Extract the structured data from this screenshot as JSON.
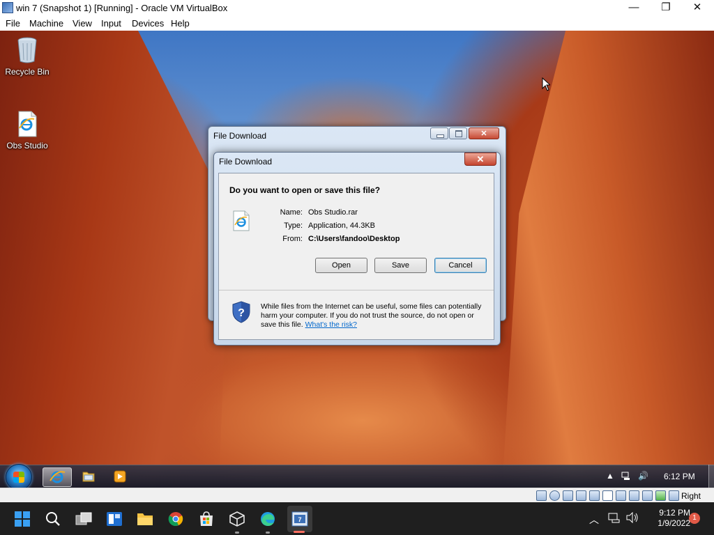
{
  "host_window": {
    "title": "win 7 (Snapshot 1) [Running] - Oracle VM VirtualBox",
    "controls": {
      "minimize": "—",
      "maximize": "❐",
      "close": "✕"
    },
    "menu": [
      "File",
      "Machine",
      "View",
      "Input",
      "Devices",
      "Help"
    ]
  },
  "desktop": {
    "icons": [
      {
        "label": "Recycle Bin",
        "icon": "recycle-bin-icon"
      },
      {
        "label": "Obs Studio",
        "icon": "ie-file-icon"
      }
    ]
  },
  "background_window": {
    "title": "File Download"
  },
  "dialog": {
    "title": "File Download",
    "close_glyph": "✕",
    "question": "Do you want to open or save this file?",
    "fields": {
      "name_label": "Name:",
      "name_value": "Obs Studio.rar",
      "type_label": "Type:",
      "type_value": "Application, 44.3KB",
      "from_label": "From:",
      "from_value": "C:\\Users\\fandoo\\Desktop"
    },
    "buttons": {
      "open": "Open",
      "save": "Save",
      "cancel": "Cancel"
    },
    "warning": "While files from the Internet can be useful, some files can potentially harm your computer. If you do not trust the source, do not open or save this file.",
    "warning_link": "What's the risk?"
  },
  "guest_taskbar": {
    "clock": "6:12 PM",
    "pinned": [
      "internet-explorer",
      "windows-explorer",
      "media-player"
    ],
    "tray_arrow": "▲",
    "volume_glyph": "🔊"
  },
  "vb_status": {
    "host_key": "Right Ctrl"
  },
  "host_taskbar": {
    "time": "9:12 PM",
    "date": "1/9/2022",
    "notifications": "1",
    "tray_arrow": "︿",
    "apps": [
      "windows-start",
      "search",
      "task-view",
      "widgets",
      "file-explorer",
      "chrome",
      "microsoft-store",
      "virtualbox",
      "edge",
      "virtualbox-vm"
    ]
  },
  "colors": {
    "dialog_frame": "#c7d7ea",
    "link": "#0066cc",
    "close_button": "#c4442f",
    "host_taskbar": "#1f1f1f"
  }
}
